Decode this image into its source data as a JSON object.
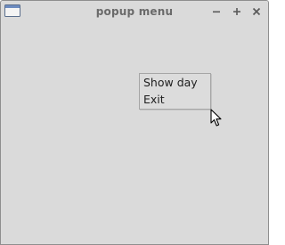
{
  "window": {
    "title": "popup menu",
    "controls": {
      "minimize": "−",
      "maximize": "+",
      "close": "×"
    }
  },
  "popup_menu": {
    "items": [
      {
        "label": "Show day"
      },
      {
        "label": "Exit"
      }
    ]
  },
  "colors": {
    "window_bg": "#dadada",
    "title_text": "#6a6a6a",
    "menu_text": "#1e1e1e",
    "menu_border": "#a6a6a6"
  },
  "icons": {
    "app": "window-icon",
    "cursor": "mouse-pointer-icon"
  }
}
